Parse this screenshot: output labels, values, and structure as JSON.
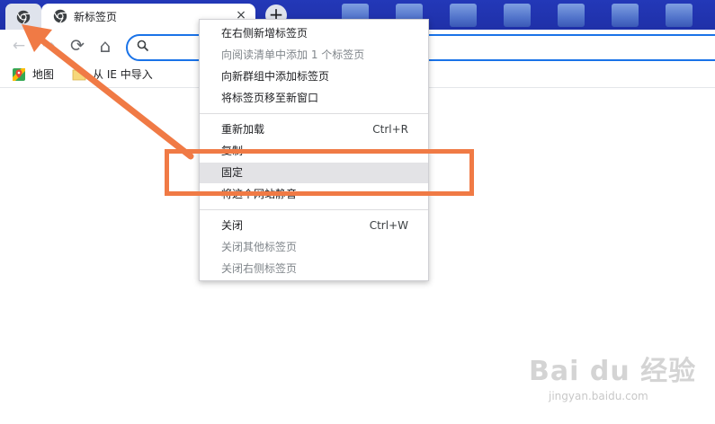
{
  "browser": {
    "active_tab_title": "新标签页",
    "close_glyph": "×",
    "new_tab_glyph": "+"
  },
  "toolbar": {
    "back_glyph": "←",
    "forward_glyph": "→",
    "reload_glyph": "⟳",
    "home_glyph": "⌂",
    "omnibox_value": ""
  },
  "bookmarks": [
    {
      "label": "地图",
      "icon": "maps-icon"
    },
    {
      "label": "从 IE 中导入",
      "icon": "folder-icon"
    }
  ],
  "context_menu": {
    "items": [
      {
        "label": "在右侧新增标签页",
        "shortcut": "",
        "enabled": true
      },
      {
        "label": "向阅读清单中添加 1 个标签页",
        "shortcut": "",
        "enabled": false
      },
      {
        "label": "向新群组中添加标签页",
        "shortcut": "",
        "enabled": true
      },
      {
        "label": "将标签页移至新窗口",
        "shortcut": "",
        "enabled": true
      },
      {
        "label": "重新加载",
        "shortcut": "Ctrl+R",
        "enabled": true
      },
      {
        "label": "复制",
        "shortcut": "",
        "enabled": true
      },
      {
        "label": "固定",
        "shortcut": "",
        "enabled": true,
        "highlighted": true
      },
      {
        "label": "将这个网站静音",
        "shortcut": "",
        "enabled": true
      },
      {
        "label": "关闭",
        "shortcut": "Ctrl+W",
        "enabled": true
      },
      {
        "label": "关闭其他标签页",
        "shortcut": "",
        "enabled": false
      },
      {
        "label": "关闭右侧标签页",
        "shortcut": "",
        "enabled": false
      }
    ]
  },
  "watermark": {
    "brand": "Bai du 经验",
    "url": "jingyan.baidu.com"
  },
  "colors": {
    "annotation": "#f07a45",
    "accent": "#1a73e8",
    "highlight": "#e3e3e6"
  }
}
